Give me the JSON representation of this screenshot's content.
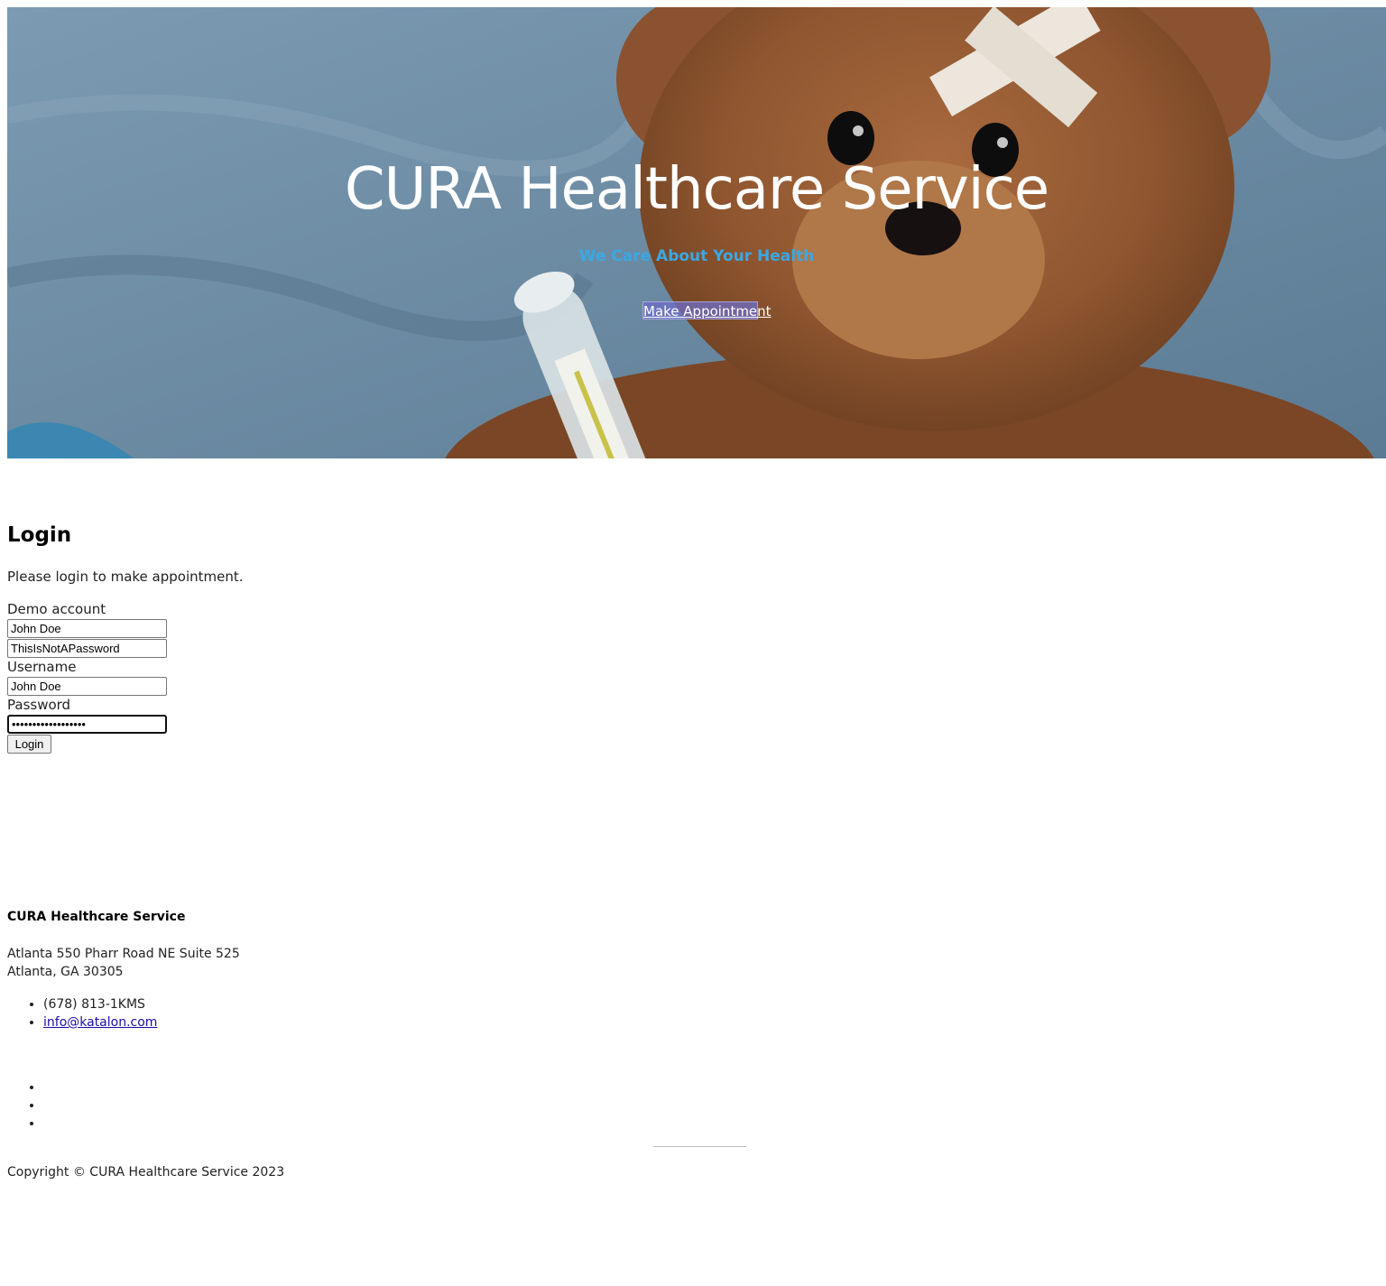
{
  "hero": {
    "title": "CURA Healthcare Service",
    "subtitle": "We Care About Your Health",
    "button_label": "Make Appointment",
    "subtitle_color": "#3aa8e4",
    "image": "teddy-bear-with-thermometer"
  },
  "login": {
    "title": "Login",
    "description": "Please login to make appointment.",
    "demo_label": "Demo account",
    "demo_username": "John Doe",
    "demo_password": "ThisIsNotAPassword",
    "username_label": "Username",
    "username_value": "John Doe",
    "password_label": "Password",
    "password_value": "ThisIsNotAPassword",
    "button_label": "Login"
  },
  "footer": {
    "company": "CURA Healthcare Service",
    "address_line1": "Atlanta 550 Pharr Road NE Suite 525",
    "address_line2": "Atlanta, GA 30305",
    "phone": "(678) 813-1KMS",
    "email": "info@katalon.com",
    "social_icons": [
      "facebook-icon",
      "twitter-icon",
      "dribbble-icon"
    ],
    "copyright": "Copyright © CURA Healthcare Service 2023"
  }
}
